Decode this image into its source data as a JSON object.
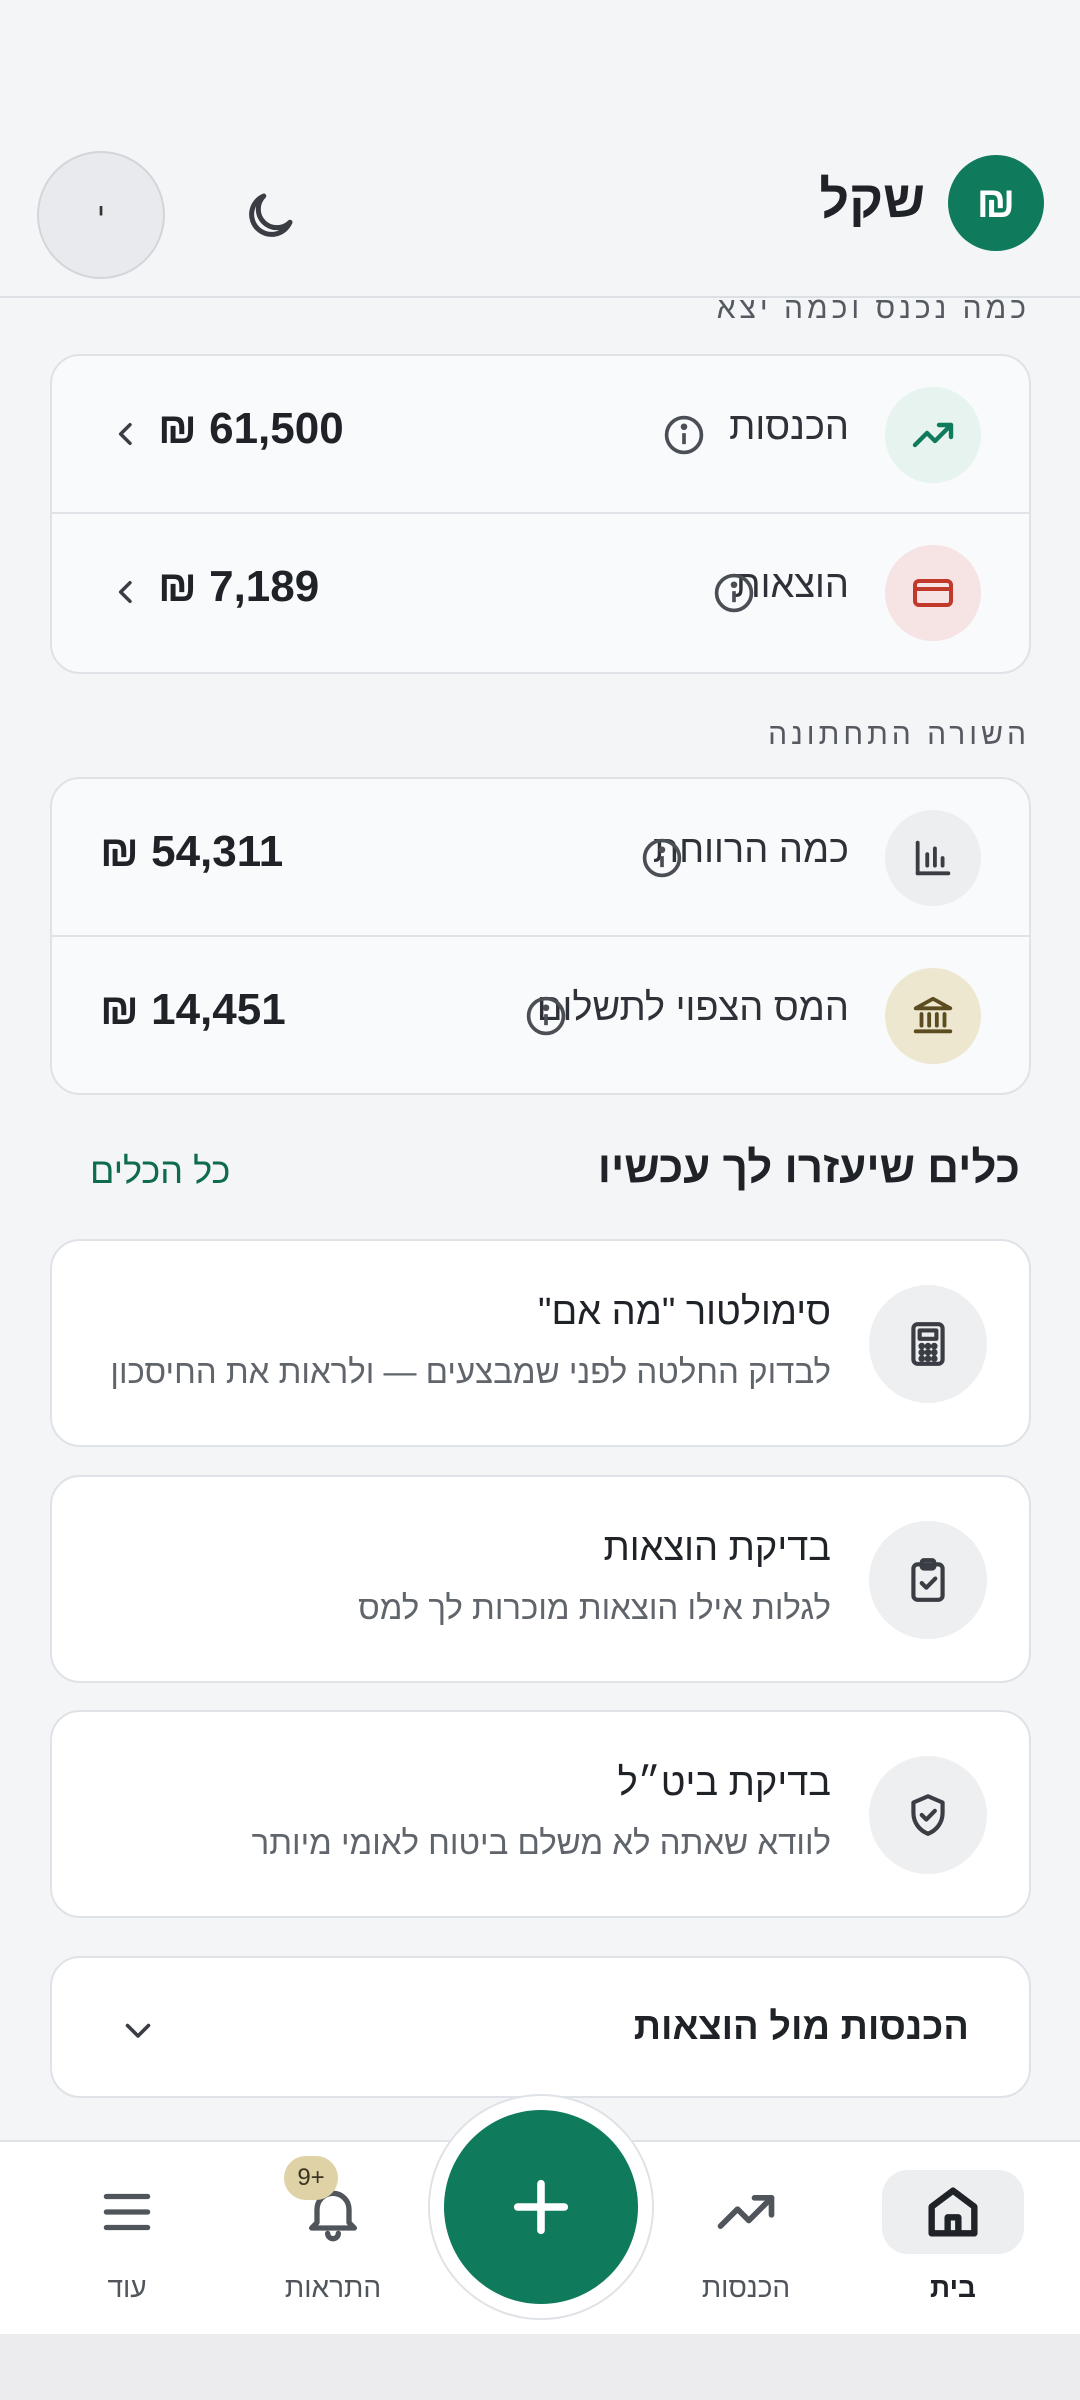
{
  "header": {
    "avatar_initial": "י",
    "brand_logo_glyph": "₪",
    "brand_name": "שקל"
  },
  "income_expense": {
    "section_label": "כמה נכנס וכמה יצא",
    "rows": [
      {
        "label": "הכנסות",
        "amount": "₪ 61,500"
      },
      {
        "label": "הוצאות",
        "amount": "₪ 7,189"
      }
    ]
  },
  "bottom_line": {
    "section_label": "השורה התחתונה",
    "rows": [
      {
        "label": "כמה הרווחת",
        "amount": "₪ 54,311"
      },
      {
        "label": "המס הצפוי לתשלום",
        "amount": "₪ 14,451"
      }
    ]
  },
  "tools": {
    "title": "כלים שיעזרו לך עכשיו",
    "all_link": "כל הכלים",
    "items": [
      {
        "title": "סימולטור \"מה אם\"",
        "subtitle": "לבדוק החלטה לפני שמבצעים — ולראות את החיסכון",
        "icon": "calculator-icon"
      },
      {
        "title": "בדיקת הוצאות",
        "subtitle": "לגלות אילו הוצאות מוכרות לך למס",
        "icon": "clipboard-check-icon"
      },
      {
        "title": "בדיקת ביט״ל",
        "subtitle": "לוודא שאתה לא משלם ביטוח לאומי מיותר",
        "icon": "shield-check-icon"
      }
    ]
  },
  "collapsible": {
    "title": "הכנסות מול הוצאות"
  },
  "nav": {
    "home": "בית",
    "income": "הכנסות",
    "alerts": "התראות",
    "alerts_badge": "9+",
    "more": "עוד"
  },
  "colors": {
    "brand": "#0f7a5c",
    "income_icon_bg": "#e6f3ee",
    "expense_icon_bg": "#f6e3e3",
    "tax_icon_bg": "#eee7cf"
  }
}
